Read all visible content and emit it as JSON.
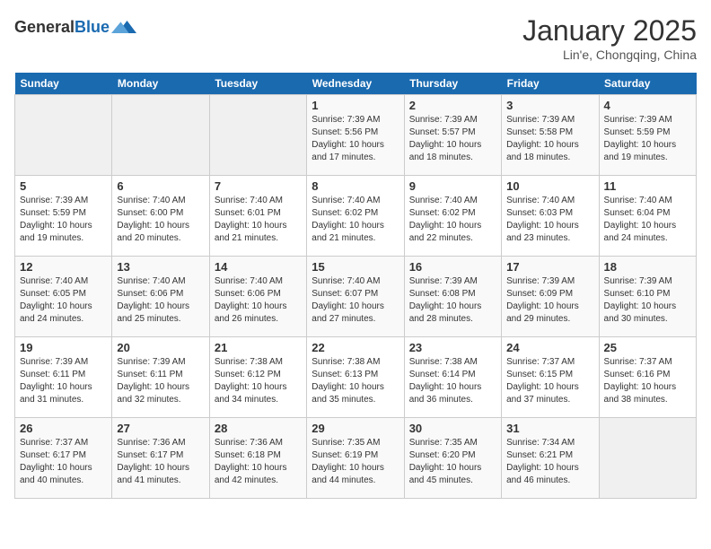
{
  "header": {
    "logo_general": "General",
    "logo_blue": "Blue",
    "title": "January 2025",
    "subtitle": "Lin'e, Chongqing, China"
  },
  "days_of_week": [
    "Sunday",
    "Monday",
    "Tuesday",
    "Wednesday",
    "Thursday",
    "Friday",
    "Saturday"
  ],
  "weeks": [
    [
      {
        "day": "",
        "info": ""
      },
      {
        "day": "",
        "info": ""
      },
      {
        "day": "",
        "info": ""
      },
      {
        "day": "1",
        "info": "Sunrise: 7:39 AM\nSunset: 5:56 PM\nDaylight: 10 hours and 17 minutes."
      },
      {
        "day": "2",
        "info": "Sunrise: 7:39 AM\nSunset: 5:57 PM\nDaylight: 10 hours and 18 minutes."
      },
      {
        "day": "3",
        "info": "Sunrise: 7:39 AM\nSunset: 5:58 PM\nDaylight: 10 hours and 18 minutes."
      },
      {
        "day": "4",
        "info": "Sunrise: 7:39 AM\nSunset: 5:59 PM\nDaylight: 10 hours and 19 minutes."
      }
    ],
    [
      {
        "day": "5",
        "info": "Sunrise: 7:39 AM\nSunset: 5:59 PM\nDaylight: 10 hours and 19 minutes."
      },
      {
        "day": "6",
        "info": "Sunrise: 7:40 AM\nSunset: 6:00 PM\nDaylight: 10 hours and 20 minutes."
      },
      {
        "day": "7",
        "info": "Sunrise: 7:40 AM\nSunset: 6:01 PM\nDaylight: 10 hours and 21 minutes."
      },
      {
        "day": "8",
        "info": "Sunrise: 7:40 AM\nSunset: 6:02 PM\nDaylight: 10 hours and 21 minutes."
      },
      {
        "day": "9",
        "info": "Sunrise: 7:40 AM\nSunset: 6:02 PM\nDaylight: 10 hours and 22 minutes."
      },
      {
        "day": "10",
        "info": "Sunrise: 7:40 AM\nSunset: 6:03 PM\nDaylight: 10 hours and 23 minutes."
      },
      {
        "day": "11",
        "info": "Sunrise: 7:40 AM\nSunset: 6:04 PM\nDaylight: 10 hours and 24 minutes."
      }
    ],
    [
      {
        "day": "12",
        "info": "Sunrise: 7:40 AM\nSunset: 6:05 PM\nDaylight: 10 hours and 24 minutes."
      },
      {
        "day": "13",
        "info": "Sunrise: 7:40 AM\nSunset: 6:06 PM\nDaylight: 10 hours and 25 minutes."
      },
      {
        "day": "14",
        "info": "Sunrise: 7:40 AM\nSunset: 6:06 PM\nDaylight: 10 hours and 26 minutes."
      },
      {
        "day": "15",
        "info": "Sunrise: 7:40 AM\nSunset: 6:07 PM\nDaylight: 10 hours and 27 minutes."
      },
      {
        "day": "16",
        "info": "Sunrise: 7:39 AM\nSunset: 6:08 PM\nDaylight: 10 hours and 28 minutes."
      },
      {
        "day": "17",
        "info": "Sunrise: 7:39 AM\nSunset: 6:09 PM\nDaylight: 10 hours and 29 minutes."
      },
      {
        "day": "18",
        "info": "Sunrise: 7:39 AM\nSunset: 6:10 PM\nDaylight: 10 hours and 30 minutes."
      }
    ],
    [
      {
        "day": "19",
        "info": "Sunrise: 7:39 AM\nSunset: 6:11 PM\nDaylight: 10 hours and 31 minutes."
      },
      {
        "day": "20",
        "info": "Sunrise: 7:39 AM\nSunset: 6:11 PM\nDaylight: 10 hours and 32 minutes."
      },
      {
        "day": "21",
        "info": "Sunrise: 7:38 AM\nSunset: 6:12 PM\nDaylight: 10 hours and 34 minutes."
      },
      {
        "day": "22",
        "info": "Sunrise: 7:38 AM\nSunset: 6:13 PM\nDaylight: 10 hours and 35 minutes."
      },
      {
        "day": "23",
        "info": "Sunrise: 7:38 AM\nSunset: 6:14 PM\nDaylight: 10 hours and 36 minutes."
      },
      {
        "day": "24",
        "info": "Sunrise: 7:37 AM\nSunset: 6:15 PM\nDaylight: 10 hours and 37 minutes."
      },
      {
        "day": "25",
        "info": "Sunrise: 7:37 AM\nSunset: 6:16 PM\nDaylight: 10 hours and 38 minutes."
      }
    ],
    [
      {
        "day": "26",
        "info": "Sunrise: 7:37 AM\nSunset: 6:17 PM\nDaylight: 10 hours and 40 minutes."
      },
      {
        "day": "27",
        "info": "Sunrise: 7:36 AM\nSunset: 6:17 PM\nDaylight: 10 hours and 41 minutes."
      },
      {
        "day": "28",
        "info": "Sunrise: 7:36 AM\nSunset: 6:18 PM\nDaylight: 10 hours and 42 minutes."
      },
      {
        "day": "29",
        "info": "Sunrise: 7:35 AM\nSunset: 6:19 PM\nDaylight: 10 hours and 44 minutes."
      },
      {
        "day": "30",
        "info": "Sunrise: 7:35 AM\nSunset: 6:20 PM\nDaylight: 10 hours and 45 minutes."
      },
      {
        "day": "31",
        "info": "Sunrise: 7:34 AM\nSunset: 6:21 PM\nDaylight: 10 hours and 46 minutes."
      },
      {
        "day": "",
        "info": ""
      }
    ]
  ]
}
